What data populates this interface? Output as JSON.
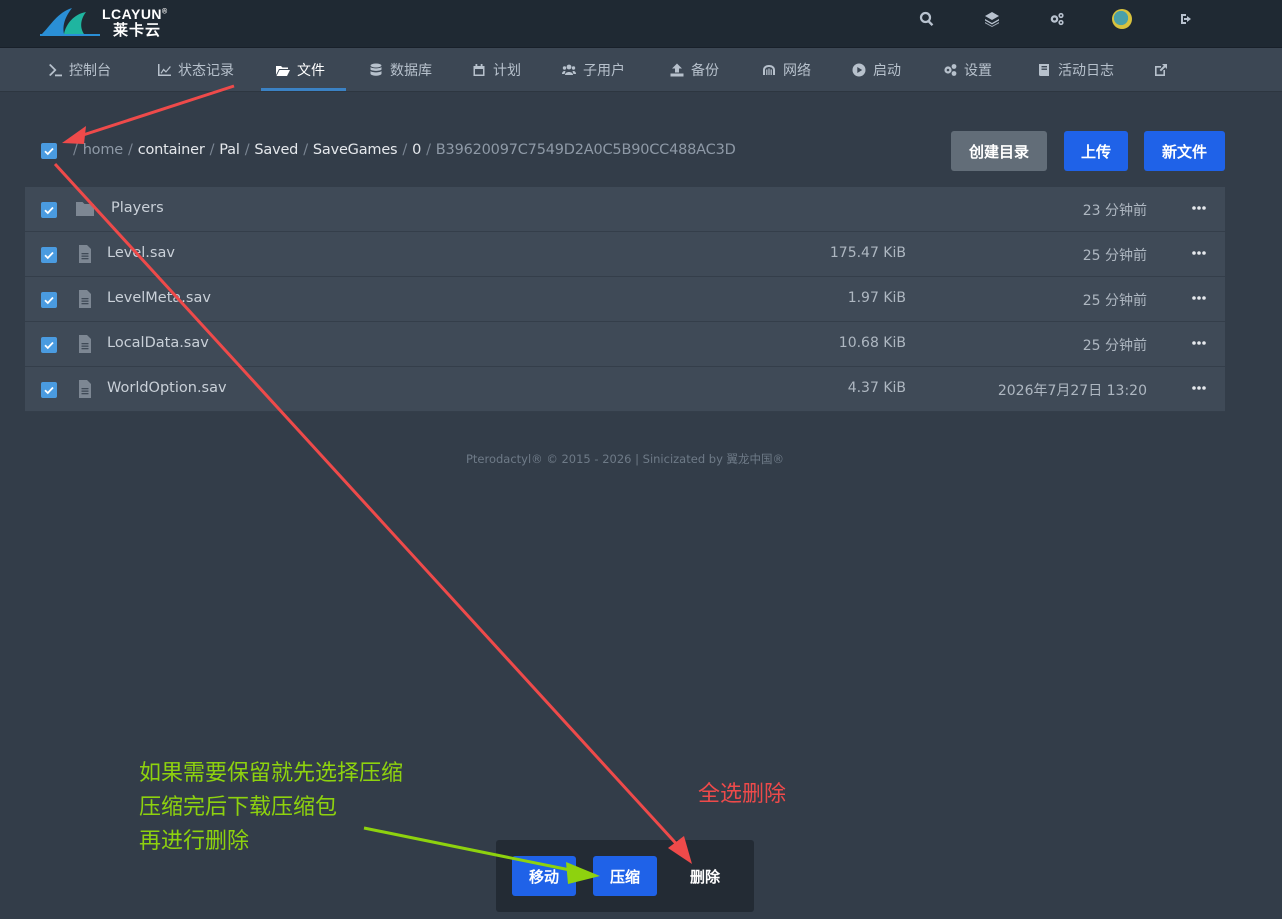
{
  "brand": {
    "name": "LCAYUN",
    "sub": "莱卡云",
    "mark": "®"
  },
  "top_icons": [
    "search-icon",
    "layers-icon",
    "cogs-icon",
    "avatar",
    "logout-icon"
  ],
  "nav": [
    {
      "label": "控制台",
      "icon": "terminal-icon"
    },
    {
      "label": "状态记录",
      "icon": "chart-icon"
    },
    {
      "label": "文件",
      "icon": "folder-open-icon",
      "active": true
    },
    {
      "label": "数据库",
      "icon": "database-icon"
    },
    {
      "label": "计划",
      "icon": "calendar-icon"
    },
    {
      "label": "子用户",
      "icon": "users-icon"
    },
    {
      "label": "备份",
      "icon": "upload-icon"
    },
    {
      "label": "网络",
      "icon": "network-icon"
    },
    {
      "label": "启动",
      "icon": "play-icon"
    },
    {
      "label": "设置",
      "icon": "cogs-icon"
    },
    {
      "label": "活动日志",
      "icon": "book-icon"
    },
    {
      "label": "",
      "icon": "external-link-icon"
    }
  ],
  "breadcrumb": {
    "segments": [
      "home",
      "container",
      "Pal",
      "Saved",
      "SaveGames",
      "0"
    ],
    "current": "B39620097C7549D2A0C5B90CC488AC3D",
    "select_all": true
  },
  "toolbar": {
    "create_dir": "创建目录",
    "upload": "上传",
    "new_file": "新文件"
  },
  "files": [
    {
      "name": "Players",
      "type": "folder",
      "size": "",
      "modified": "23 分钟前",
      "checked": true
    },
    {
      "name": "Level.sav",
      "type": "file",
      "size": "175.47 KiB",
      "modified": "25 分钟前",
      "checked": true
    },
    {
      "name": "LevelMeta.sav",
      "type": "file",
      "size": "1.97 KiB",
      "modified": "25 分钟前",
      "checked": true
    },
    {
      "name": "LocalData.sav",
      "type": "file",
      "size": "10.68 KiB",
      "modified": "25 分钟前",
      "checked": true
    },
    {
      "name": "WorldOption.sav",
      "type": "file",
      "size": "4.37 KiB",
      "modified": "2026年7月27日 13:20",
      "checked": true
    }
  ],
  "footer": "Pterodactyl® © 2015 - 2026 | Sinicizated by 翼龙中国®",
  "actions": {
    "move": "移动",
    "compress": "压缩",
    "delete": "删除"
  },
  "annotations": {
    "green_lines": [
      "如果需要保留就先选择压缩",
      "压缩完后下载压缩包",
      "再进行删除"
    ],
    "red": "全选删除"
  },
  "colors": {
    "accent_blue": "#1f62e8",
    "checkbox_blue": "#4a9be0",
    "annotation_red": "#ee4a4a",
    "annotation_green": "#8ed20e"
  }
}
